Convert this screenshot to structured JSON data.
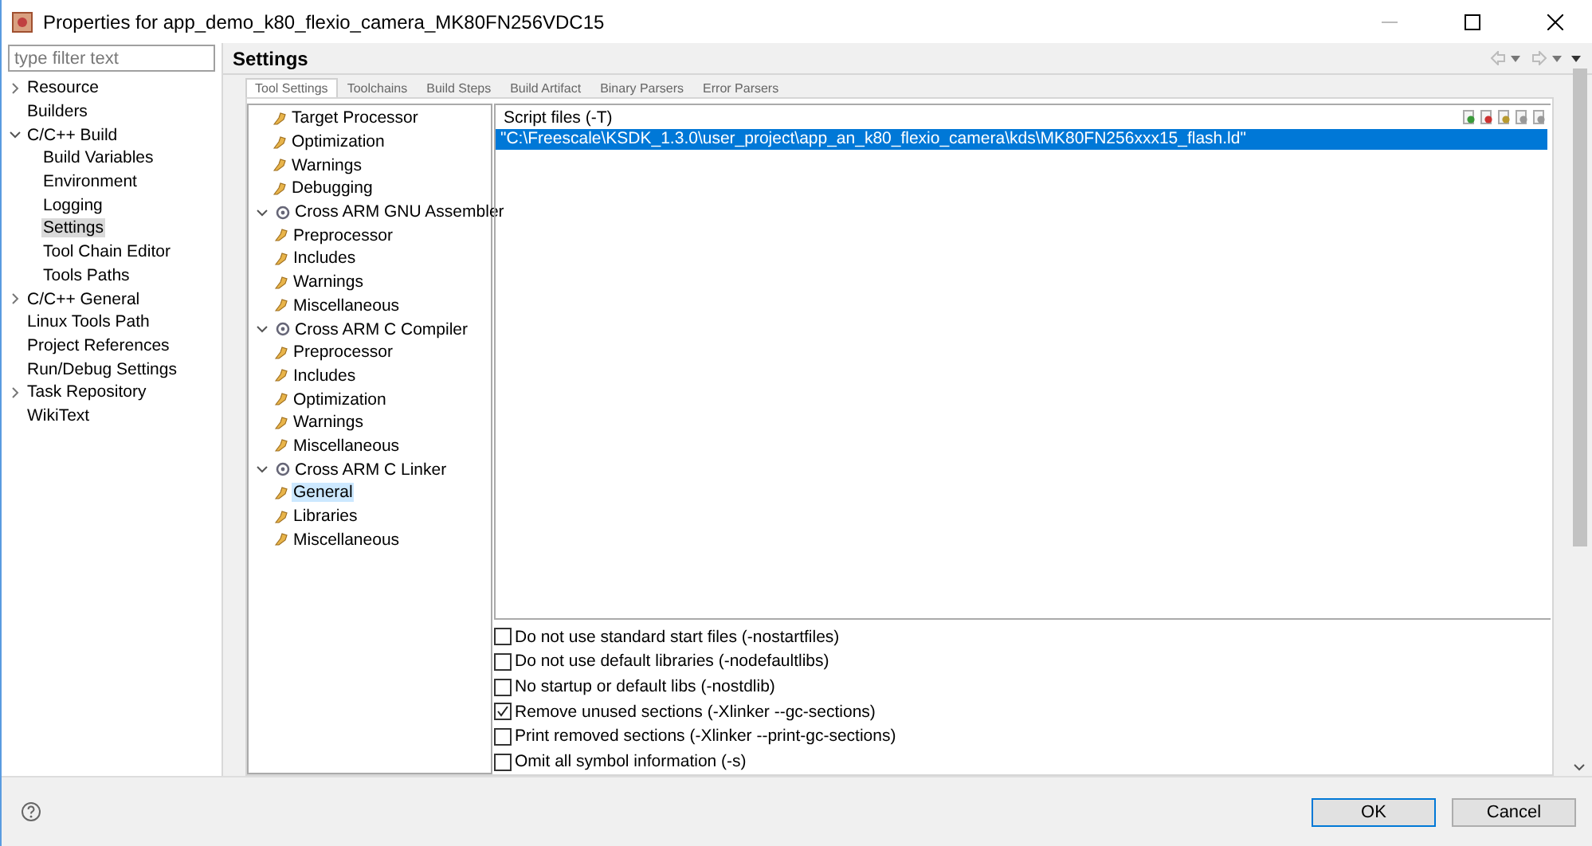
{
  "window": {
    "title": "Properties for app_demo_k80_flexio_camera_MK80FN256VDC15"
  },
  "filter": {
    "placeholder": "type filter text"
  },
  "nav": [
    {
      "label": "Resource",
      "expanded": false,
      "selected": false
    },
    {
      "label": "Builders",
      "selected": false
    },
    {
      "label": "C/C++ Build",
      "expanded": true,
      "selected": false,
      "children": [
        {
          "label": "Build Variables",
          "selected": false
        },
        {
          "label": "Environment",
          "selected": false
        },
        {
          "label": "Logging",
          "selected": false
        },
        {
          "label": "Settings",
          "selected": true
        },
        {
          "label": "Tool Chain Editor",
          "selected": false
        },
        {
          "label": "Tools Paths",
          "selected": false
        }
      ]
    },
    {
      "label": "C/C++ General",
      "expanded": false,
      "selected": false
    },
    {
      "label": "Linux Tools Path",
      "selected": false
    },
    {
      "label": "Project References",
      "selected": false
    },
    {
      "label": "Run/Debug Settings",
      "selected": false
    },
    {
      "label": "Task Repository",
      "expanded": false,
      "selected": false
    },
    {
      "label": "WikiText",
      "selected": false
    }
  ],
  "page_title": "Settings",
  "tabs": [
    {
      "label": "Tool Settings",
      "selected": true
    },
    {
      "label": "Toolchains",
      "selected": false
    },
    {
      "label": "Build Steps",
      "selected": false
    },
    {
      "label": "Build Artifact",
      "selected": false
    },
    {
      "label": "Binary Parsers",
      "selected": false
    },
    {
      "label": "Error Parsers",
      "selected": false
    }
  ],
  "tool_tree": [
    {
      "kind": "option",
      "label": "Target Processor",
      "selected": false
    },
    {
      "kind": "option",
      "label": "Optimization",
      "selected": false
    },
    {
      "kind": "option",
      "label": "Warnings",
      "selected": false
    },
    {
      "kind": "option",
      "label": "Debugging",
      "selected": false
    },
    {
      "kind": "tool",
      "label": "Cross ARM GNU Assembler",
      "expanded": true,
      "selected": false,
      "children": [
        {
          "kind": "option",
          "label": "Preprocessor",
          "selected": false
        },
        {
          "kind": "option",
          "label": "Includes",
          "selected": false
        },
        {
          "kind": "option",
          "label": "Warnings",
          "selected": false
        },
        {
          "kind": "option",
          "label": "Miscellaneous",
          "selected": false
        }
      ]
    },
    {
      "kind": "tool",
      "label": "Cross ARM C Compiler",
      "expanded": true,
      "selected": false,
      "children": [
        {
          "kind": "option",
          "label": "Preprocessor",
          "selected": false
        },
        {
          "kind": "option",
          "label": "Includes",
          "selected": false
        },
        {
          "kind": "option",
          "label": "Optimization",
          "selected": false
        },
        {
          "kind": "option",
          "label": "Warnings",
          "selected": false
        },
        {
          "kind": "option",
          "label": "Miscellaneous",
          "selected": false
        }
      ]
    },
    {
      "kind": "tool",
      "label": "Cross ARM C Linker",
      "expanded": true,
      "selected": false,
      "children": [
        {
          "kind": "option",
          "label": "General",
          "selected": true
        },
        {
          "kind": "option",
          "label": "Libraries",
          "selected": false
        },
        {
          "kind": "option",
          "label": "Miscellaneous",
          "selected": false
        }
      ]
    }
  ],
  "script_files": {
    "label": "Script files (-T)",
    "items": [
      {
        "text": "\"C:\\Freescale\\KSDK_1.3.0\\user_project\\app_an_k80_flexio_camera\\kds\\MK80FN256xxx15_flash.ld\"",
        "selected": true
      }
    ]
  },
  "options": [
    {
      "label": "Do not use standard start files (-nostartfiles)",
      "checked": false
    },
    {
      "label": "Do not use default libraries (-nodefaultlibs)",
      "checked": false
    },
    {
      "label": "No startup or default libs (-nostdlib)",
      "checked": false
    },
    {
      "label": "Remove unused sections (-Xlinker --gc-sections)",
      "checked": true
    },
    {
      "label": "Print removed sections (-Xlinker --print-gc-sections)",
      "checked": false
    },
    {
      "label": "Omit all symbol information (-s)",
      "checked": false
    }
  ],
  "buttons": [
    {
      "label": "OK",
      "default": true
    },
    {
      "label": "Cancel",
      "default": false
    }
  ]
}
